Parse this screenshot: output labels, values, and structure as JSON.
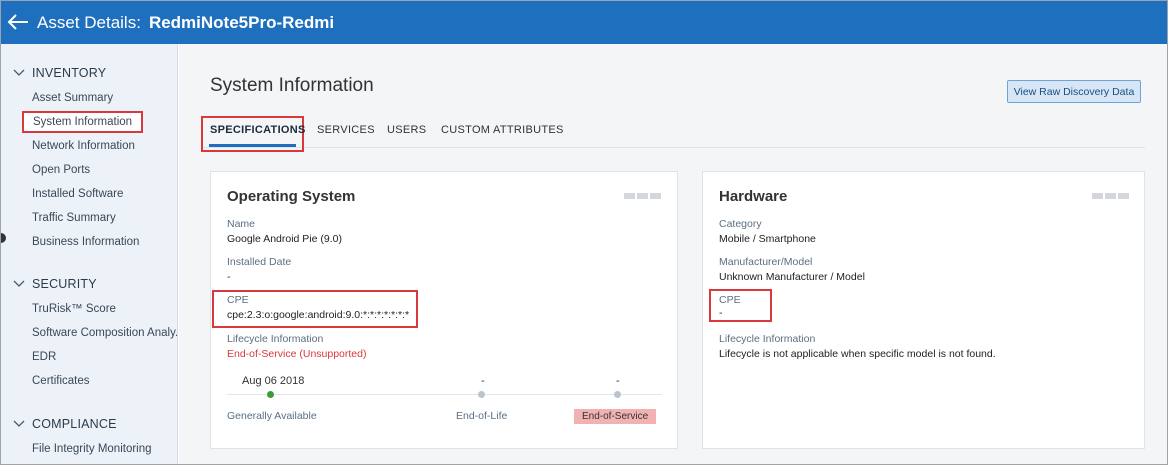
{
  "header": {
    "title_prefix": "Asset Details:",
    "asset_name": "RedmiNote5Pro-Redmi",
    "back_icon": "arrow-left-icon"
  },
  "sidebar": {
    "inventory": {
      "label": "INVENTORY",
      "items": [
        "Asset Summary",
        "System Information",
        "Network Information",
        "Open Ports",
        "Installed Software",
        "Traffic Summary",
        "Business Information"
      ]
    },
    "security": {
      "label": "SECURITY",
      "items": [
        "TruRisk™ Score",
        "Software Composition Analy...",
        "EDR",
        "Certificates"
      ]
    },
    "compliance": {
      "label": "COMPLIANCE",
      "items": [
        "File Integrity Monitoring"
      ]
    },
    "selected": "System Information"
  },
  "main": {
    "title": "System Information",
    "raw_button": "View Raw Discovery Data",
    "tabs": [
      "SPECIFICATIONS",
      "SERVICES",
      "USERS",
      "CUSTOM ATTRIBUTES"
    ],
    "active_tab": "SPECIFICATIONS"
  },
  "os_card": {
    "title": "Operating System",
    "name_label": "Name",
    "name_value": "Google Android Pie (9.0)",
    "installed_label": "Installed Date",
    "installed_value": "-",
    "cpe_label": "CPE",
    "cpe_value": "cpe:2.3:o:google:android:9.0:*:*:*:*:*:*:*",
    "lifecycle_label": "Lifecycle Information",
    "lifecycle_value": "End-of-Service (Unsupported)",
    "timeline": {
      "ga_date": "Aug 06 2018",
      "eol_date": "-",
      "eos_date": "-",
      "ga_label": "Generally Available",
      "eol_label": "End-of-Life",
      "eos_label": "End-of-Service"
    }
  },
  "hw_card": {
    "title": "Hardware",
    "category_label": "Category",
    "category_value": "Mobile / Smartphone",
    "manufacturer_label": "Manufacturer/Model",
    "manufacturer_value": "Unknown Manufacturer / Model",
    "cpe_label": "CPE",
    "cpe_value": "-",
    "lifecycle_label": "Lifecycle Information",
    "lifecycle_value": "Lifecycle is not applicable when specific model is not found."
  },
  "colors": {
    "header": "#1f6fbf",
    "highlight": "#d9383c",
    "end_of_service": "#d9383c"
  }
}
